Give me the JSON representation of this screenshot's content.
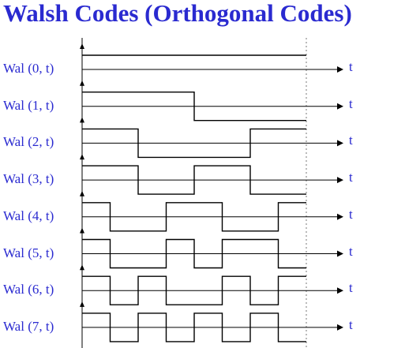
{
  "title": "Walsh Codes (Orthogonal Codes)",
  "axis_label": "t",
  "colors": {
    "text": "#2a2ad0",
    "wave": "#000000",
    "dashed": "#777777"
  },
  "codes": [
    {
      "label": "Wal (0, t)",
      "chips": [
        1,
        1,
        1,
        1,
        1,
        1,
        1,
        1
      ]
    },
    {
      "label": "Wal (1, t)",
      "chips": [
        1,
        1,
        1,
        1,
        -1,
        -1,
        -1,
        -1
      ]
    },
    {
      "label": "Wal (2, t)",
      "chips": [
        1,
        1,
        -1,
        -1,
        -1,
        -1,
        1,
        1
      ]
    },
    {
      "label": "Wal (3, t)",
      "chips": [
        1,
        1,
        -1,
        -1,
        1,
        1,
        -1,
        -1
      ]
    },
    {
      "label": "Wal (4, t)",
      "chips": [
        1,
        -1,
        -1,
        1,
        1,
        -1,
        -1,
        1
      ]
    },
    {
      "label": "Wal (5, t)",
      "chips": [
        1,
        -1,
        -1,
        1,
        -1,
        1,
        1,
        -1
      ]
    },
    {
      "label": "Wal (6, t)",
      "chips": [
        1,
        -1,
        1,
        -1,
        -1,
        1,
        -1,
        1
      ]
    },
    {
      "label": "Wal (7, t)",
      "chips": [
        1,
        -1,
        1,
        -1,
        1,
        -1,
        1,
        -1
      ]
    }
  ]
}
